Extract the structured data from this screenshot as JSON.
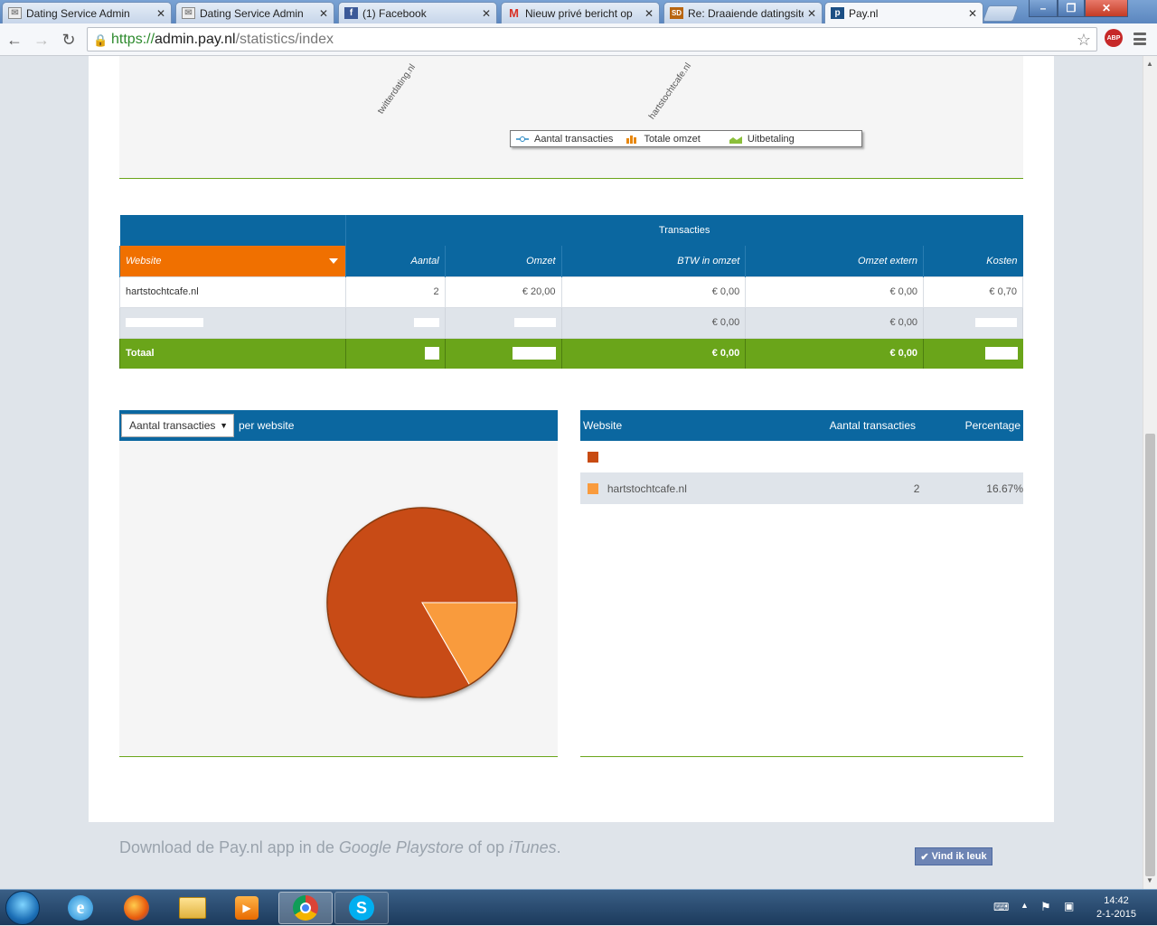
{
  "browser": {
    "tabs": [
      {
        "title": "Dating Service Admin",
        "icon": "mail-icon"
      },
      {
        "title": "Dating Service Admin",
        "icon": "mail-icon"
      },
      {
        "title": "(1) Facebook",
        "icon": "facebook-icon"
      },
      {
        "title": "Nieuw privé bericht op",
        "icon": "gmail-icon"
      },
      {
        "title": "Re: Draaiende datingsite",
        "icon": "forum-icon"
      },
      {
        "title": "Pay.nl",
        "icon": "paynl-icon"
      }
    ],
    "url_scheme": "https://",
    "url_host": "admin.pay.nl",
    "url_path": "/statistics/index",
    "abp_label": "ABP"
  },
  "chart": {
    "x_labels": [
      "twitterdating.nl",
      "hartstochtcafe.nl"
    ],
    "legend": [
      "Aantal transacties",
      "Totale omzet",
      "Uitbetaling"
    ]
  },
  "table": {
    "group_header": "Transacties",
    "website_header": "Website",
    "columns": [
      "Aantal",
      "Omzet",
      "BTW in omzet",
      "Omzet extern",
      "Kosten"
    ],
    "rows": [
      {
        "site": "hartstochtcafe.nl",
        "aantal": "2",
        "omzet": "€ 20,00",
        "btw": "€ 0,00",
        "extern": "€ 0,00",
        "kosten": "€ 0,70"
      },
      {
        "site": "",
        "aantal": "",
        "omzet": "",
        "btw": "€ 0,00",
        "extern": "€ 0,00",
        "kosten": ""
      }
    ],
    "total": {
      "label": "Totaal",
      "btw": "€ 0,00",
      "extern": "€ 0,00"
    }
  },
  "pie": {
    "select_value": "Aantal transacties",
    "suffix": "per website",
    "slices": [
      {
        "value": 83.33,
        "color": "#c84b12"
      },
      {
        "value": 16.67,
        "color": "#f99b3d"
      }
    ]
  },
  "site_table": {
    "headers": [
      "Website",
      "Aantal transacties",
      "Percentage"
    ],
    "rows": [
      {
        "site": "",
        "aantal": "",
        "pct": "",
        "color": "#c84b12"
      },
      {
        "site": "hartstochtcafe.nl",
        "aantal": "2",
        "pct": "16.67%",
        "color": "#f99b3d"
      }
    ]
  },
  "footer": {
    "text_prefix": "Download de Pay.nl app in de ",
    "playstore": "Google Playstore",
    "text_mid": " of op ",
    "itunes": "iTunes",
    "text_end": ".",
    "like_label": "Vind ik leuk"
  },
  "taskbar": {
    "time": "14:42",
    "date": "2-1-2015"
  }
}
